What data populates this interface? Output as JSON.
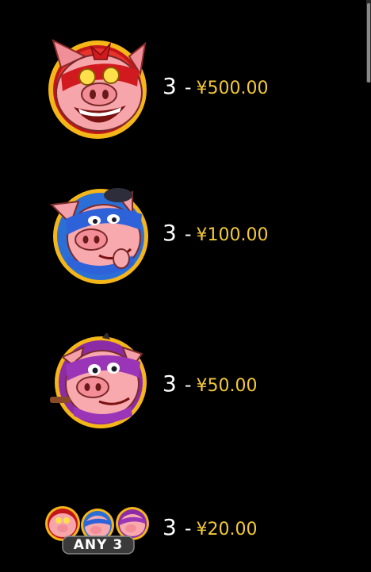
{
  "paytable": {
    "rows": [
      {
        "symbol_icon": "red-pig-icon",
        "count": "3",
        "dash": "-",
        "amount": "¥500.00"
      },
      {
        "symbol_icon": "blue-pig-icon",
        "count": "3",
        "dash": "-",
        "amount": "¥100.00"
      },
      {
        "symbol_icon": "purple-pig-icon",
        "count": "3",
        "dash": "-",
        "amount": "¥50.00"
      },
      {
        "symbol_icon": "any-three-pigs-icon",
        "count": "3",
        "dash": "-",
        "amount": "¥20.00"
      }
    ],
    "any_label": "ANY 3"
  },
  "colors": {
    "background": "#000000",
    "amount": "#f3c935",
    "text": "#ffffff"
  }
}
